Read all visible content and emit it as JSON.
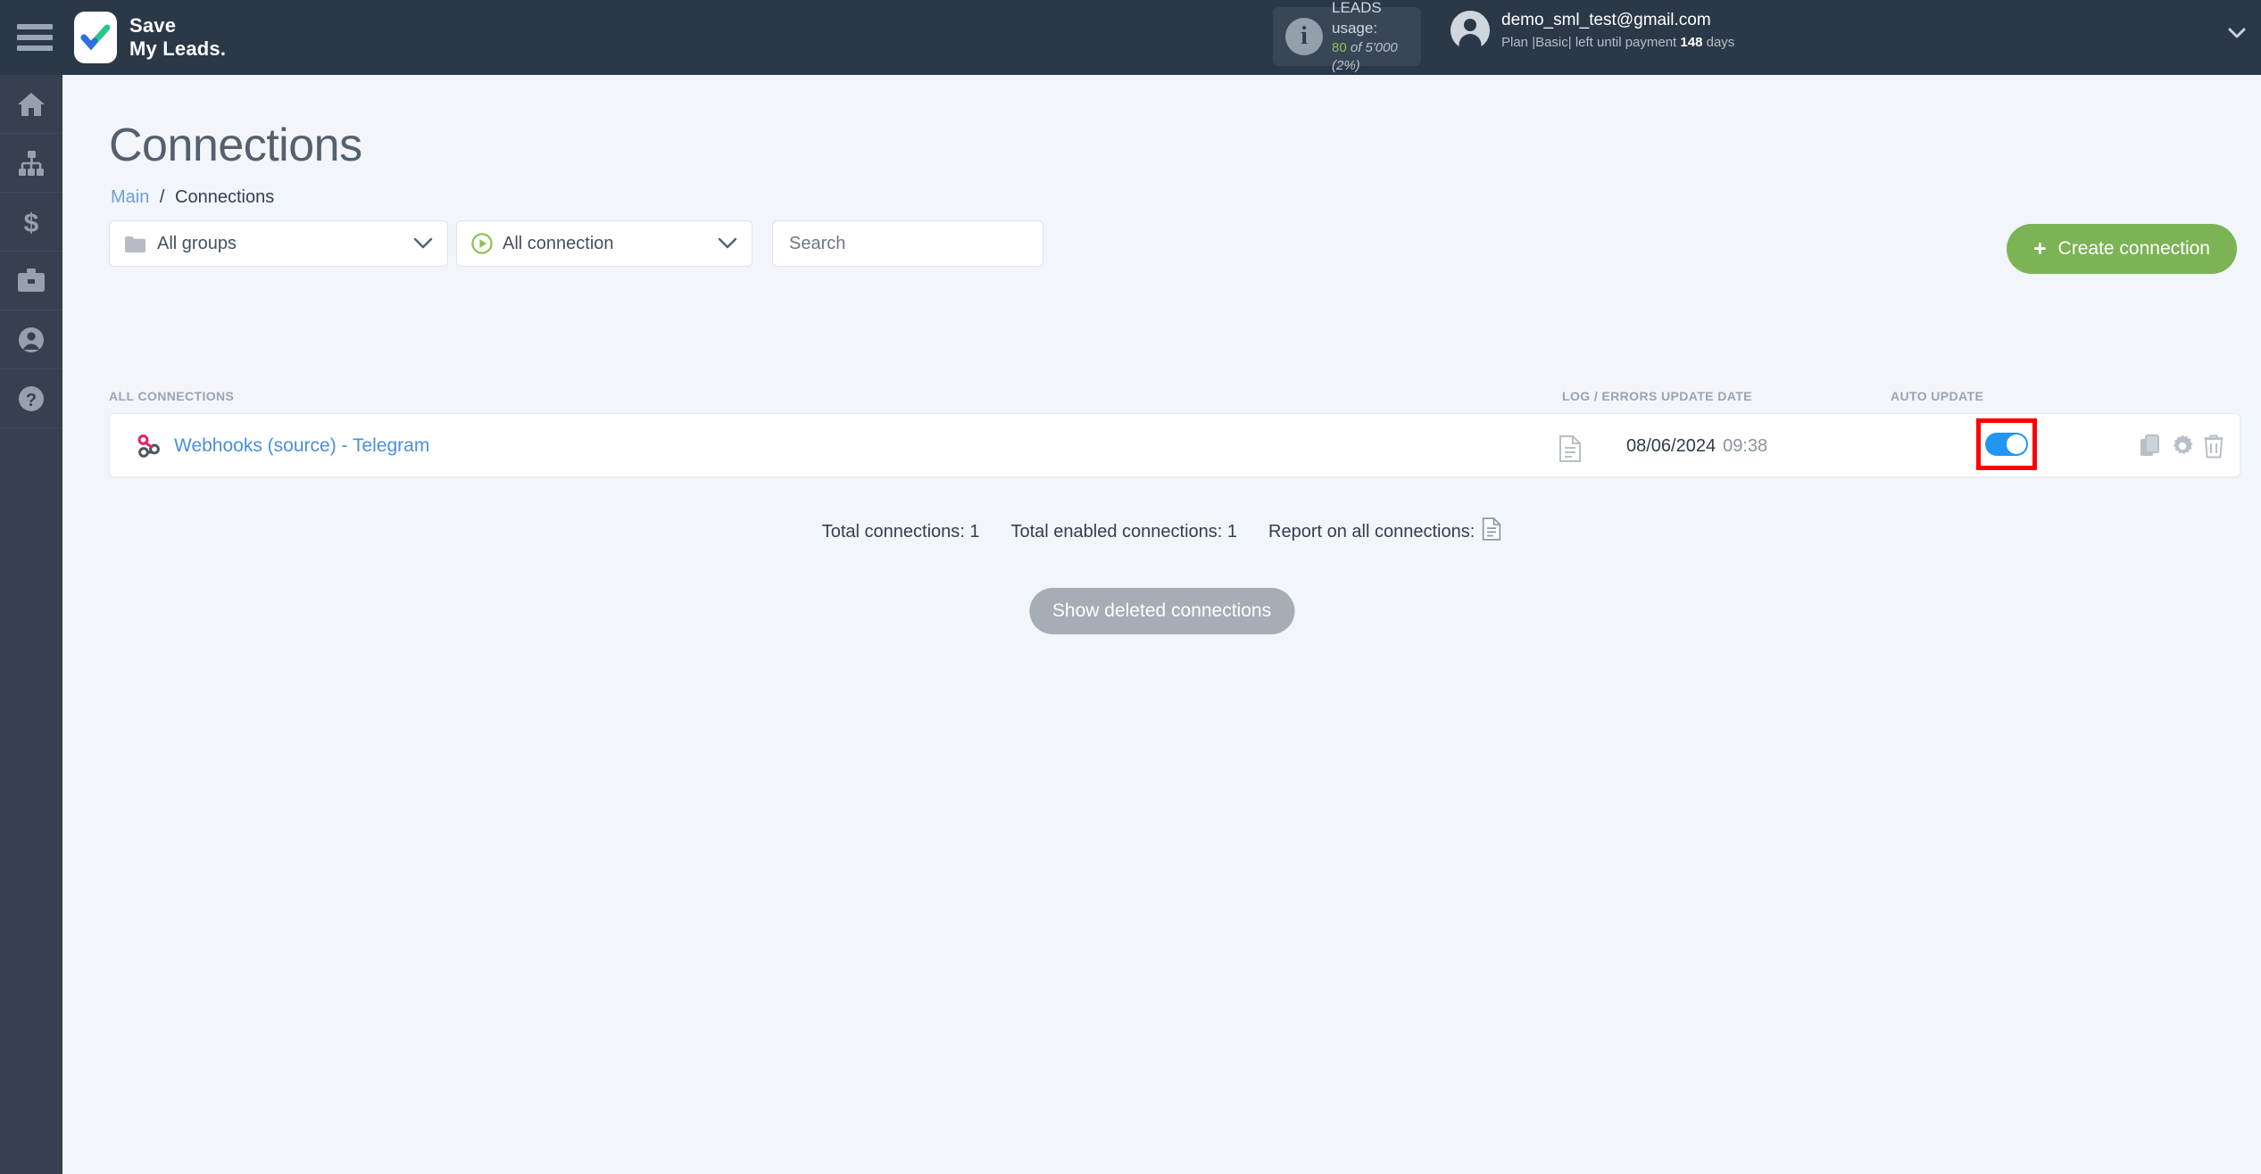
{
  "brand": {
    "line1": "Save",
    "line2": "My Leads.",
    "logo_icon": "checkmark-logo-icon"
  },
  "topbar": {
    "menu_icon": "hamburger-menu-icon",
    "leads": {
      "icon": "info-circle-icon",
      "title": "LEADS usage:",
      "used": "80",
      "of": "of 5'000",
      "percent": "(2%)"
    },
    "account": {
      "avatar_icon": "user-avatar-icon",
      "email": "demo_sml_test@gmail.com",
      "plan_prefix": "Plan |Basic| left until payment",
      "days_value": "148",
      "days_suffix": "days"
    },
    "collapse_icon": "chevron-down-icon"
  },
  "sidebar": {
    "items": [
      {
        "icon": "home-icon",
        "name": "main"
      },
      {
        "icon": "sitemap-icon",
        "name": "connections"
      },
      {
        "icon": "dollar-icon",
        "name": "payments"
      },
      {
        "icon": "briefcase-icon",
        "name": "business"
      },
      {
        "icon": "user-icon",
        "name": "profile"
      },
      {
        "icon": "question-circle-icon",
        "name": "help"
      }
    ]
  },
  "page": {
    "title": "Connections",
    "breadcrumb": {
      "root": "Main",
      "separator": "/",
      "current": "Connections"
    }
  },
  "filters": {
    "groups": {
      "icon": "folder-icon",
      "value": "All groups",
      "chevron": "chevron-down-icon"
    },
    "connection": {
      "icon": "play-circle-icon",
      "value": "All connection",
      "chevron": "chevron-down-icon"
    },
    "search": {
      "value": "",
      "placeholder": "Search"
    }
  },
  "create_button": {
    "plus": "+",
    "label": "Create connection",
    "color": "#7cb355"
  },
  "table": {
    "columns": [
      "ALL CONNECTIONS",
      "LOG / ERRORS",
      "UPDATE DATE",
      "AUTO UPDATE"
    ],
    "rows": [
      {
        "icon": "webhook-icon",
        "name": "Webhooks (source) - Telegram",
        "log_icon": "document-report-icon",
        "date": "08/06/2024",
        "time": "09:38",
        "auto_update": "on",
        "toggle_highlight_color": "#fd0000",
        "actions": [
          "copy-icon",
          "gear-icon",
          "trash-icon"
        ]
      }
    ]
  },
  "footer": {
    "total_connections": "Total connections: 1",
    "total_enabled": "Total enabled connections: 1",
    "report_label": "Report on all connections:",
    "report_icon": "document-report-icon",
    "show_deleted_label": "Show deleted connections"
  }
}
